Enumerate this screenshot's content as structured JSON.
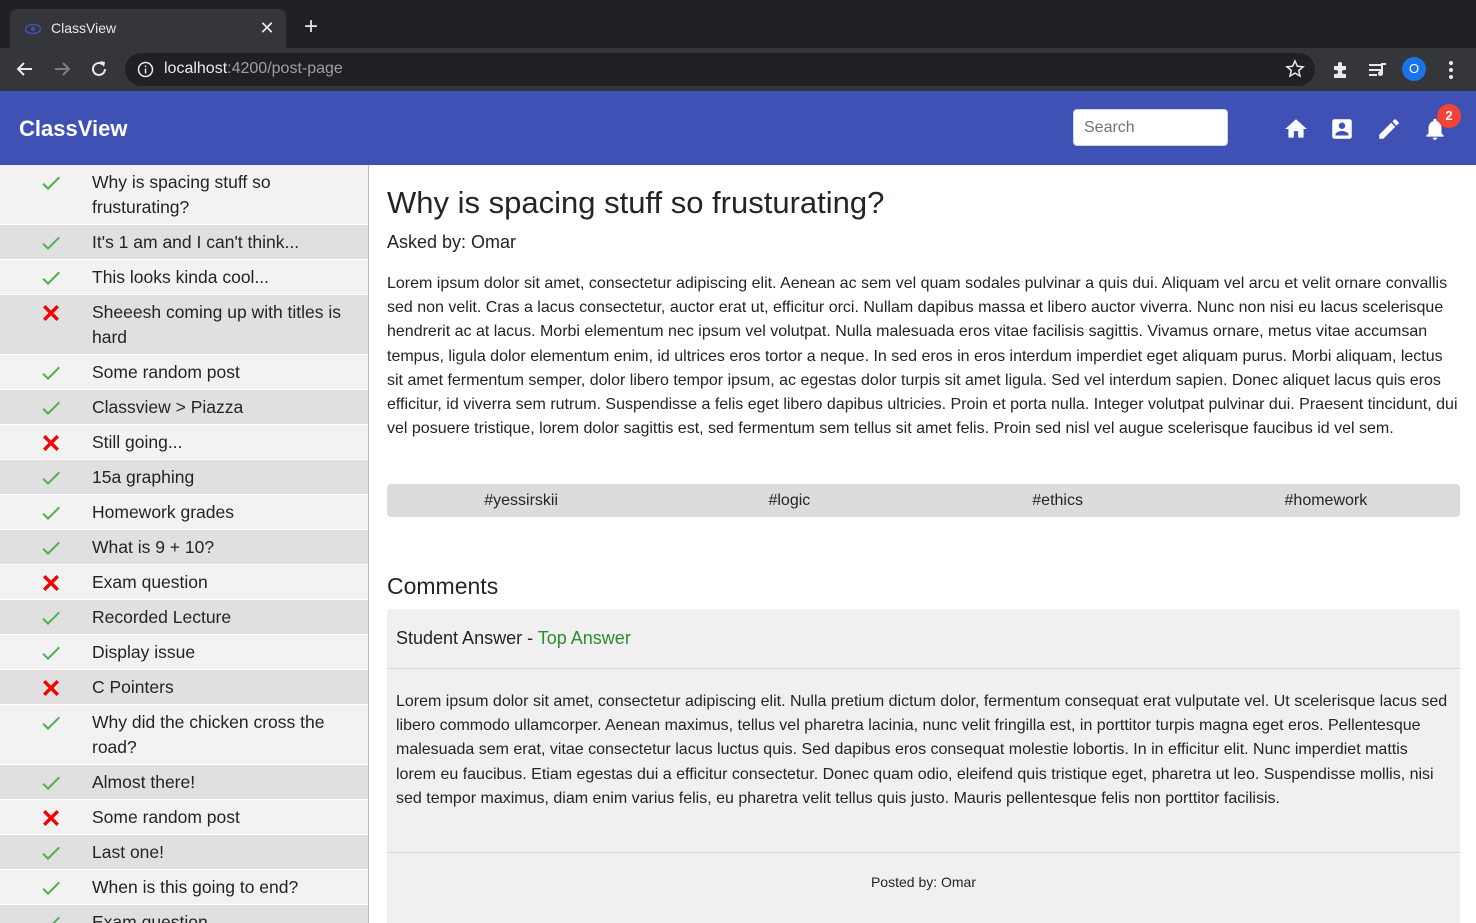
{
  "browser": {
    "tab_title": "ClassView",
    "url_host": "localhost",
    "url_rest": ":4200/post-page",
    "profile_initial": "O"
  },
  "navbar": {
    "brand": "ClassView",
    "search_placeholder": "Search",
    "notification_count": "2",
    "color": "#3f51b5"
  },
  "sidebar": {
    "items": [
      {
        "status": "check",
        "label": "Why is spacing stuff so frusturating?"
      },
      {
        "status": "check",
        "label": "It's 1 am and I can't think..."
      },
      {
        "status": "check",
        "label": "This looks kinda cool..."
      },
      {
        "status": "cross",
        "label": "Sheeesh coming up with titles is hard"
      },
      {
        "status": "check",
        "label": "Some random post"
      },
      {
        "status": "check",
        "label": "Classview > Piazza"
      },
      {
        "status": "cross",
        "label": "Still going..."
      },
      {
        "status": "check",
        "label": "15a graphing"
      },
      {
        "status": "check",
        "label": "Homework grades"
      },
      {
        "status": "check",
        "label": "What is 9 + 10?"
      },
      {
        "status": "cross",
        "label": "Exam question"
      },
      {
        "status": "check",
        "label": "Recorded Lecture"
      },
      {
        "status": "check",
        "label": "Display issue"
      },
      {
        "status": "cross",
        "label": "C Pointers"
      },
      {
        "status": "check",
        "label": "Why did the chicken cross the road?"
      },
      {
        "status": "check",
        "label": "Almost there!"
      },
      {
        "status": "cross",
        "label": "Some random post"
      },
      {
        "status": "check",
        "label": "Last one!"
      },
      {
        "status": "check",
        "label": "When is this going to end?"
      },
      {
        "status": "check",
        "label": "Exam question"
      }
    ],
    "check_color": "#4caf50",
    "cross_color": "#f40000"
  },
  "post": {
    "title": "Why is spacing stuff so frusturating?",
    "asked_by": "Asked by: Omar",
    "body": "Lorem ipsum dolor sit amet, consectetur adipiscing elit. Aenean ac sem vel quam sodales pulvinar a quis dui. Aliquam vel arcu et velit ornare convallis sed non velit. Cras a lacus consectetur, auctor erat ut, efficitur orci. Nullam dapibus massa et libero auctor viverra. Nunc non nisi eu lacus scelerisque hendrerit ac at lacus. Morbi elementum nec ipsum vel volutpat. Nulla malesuada eros vitae facilisis sagittis. Vivamus ornare, metus vitae accumsan tempus, ligula dolor elementum enim, id ultrices eros tortor a neque. In sed eros in eros interdum imperdiet eget aliquam purus. Morbi aliquam, lectus sit amet fermentum semper, dolor libero tempor ipsum, ac egestas dolor turpis sit amet ligula. Sed vel interdum sapien. Donec aliquet lacus quis eros efficitur, id viverra sem rutrum. Suspendisse a felis eget libero dapibus ultricies. Proin et porta nulla. Integer volutpat pulvinar dui. Praesent tincidunt, dui vel posuere tristique, lorem dolor sagittis est, sed fermentum sem tellus sit amet felis. Proin sed nisl vel augue scelerisque faucibus id vel sem.",
    "tags": [
      "#yessirskii",
      "#logic",
      "#ethics",
      "#homework"
    ]
  },
  "comments": {
    "title": "Comments",
    "items": [
      {
        "author_label": "Student Answer",
        "separator": " - ",
        "top_label": "Top Answer",
        "body": "Lorem ipsum dolor sit amet, consectetur adipiscing elit. Nulla pretium dictum dolor, fermentum consequat erat vulputate vel. Ut scelerisque lacus sed libero commodo ullamcorper. Aenean maximus, tellus vel pharetra lacinia, nunc velit fringilla est, in porttitor turpis magna eget eros. Pellentesque malesuada sem erat, vitae consectetur lacus luctus quis. Sed dapibus eros consequat molestie lobortis. In in efficitur elit. Nunc imperdiet mattis lorem eu faucibus. Etiam egestas dui a efficitur consectetur. Donec quam odio, eleifend quis tristique eget, pharetra ut leo. Suspendisse mollis, nisi sed tempor maximus, diam enim varius felis, eu pharetra velit tellus quis justo. Mauris pellentesque felis non porttitor facilisis.",
        "footer": "Posted by: Omar"
      }
    ]
  }
}
